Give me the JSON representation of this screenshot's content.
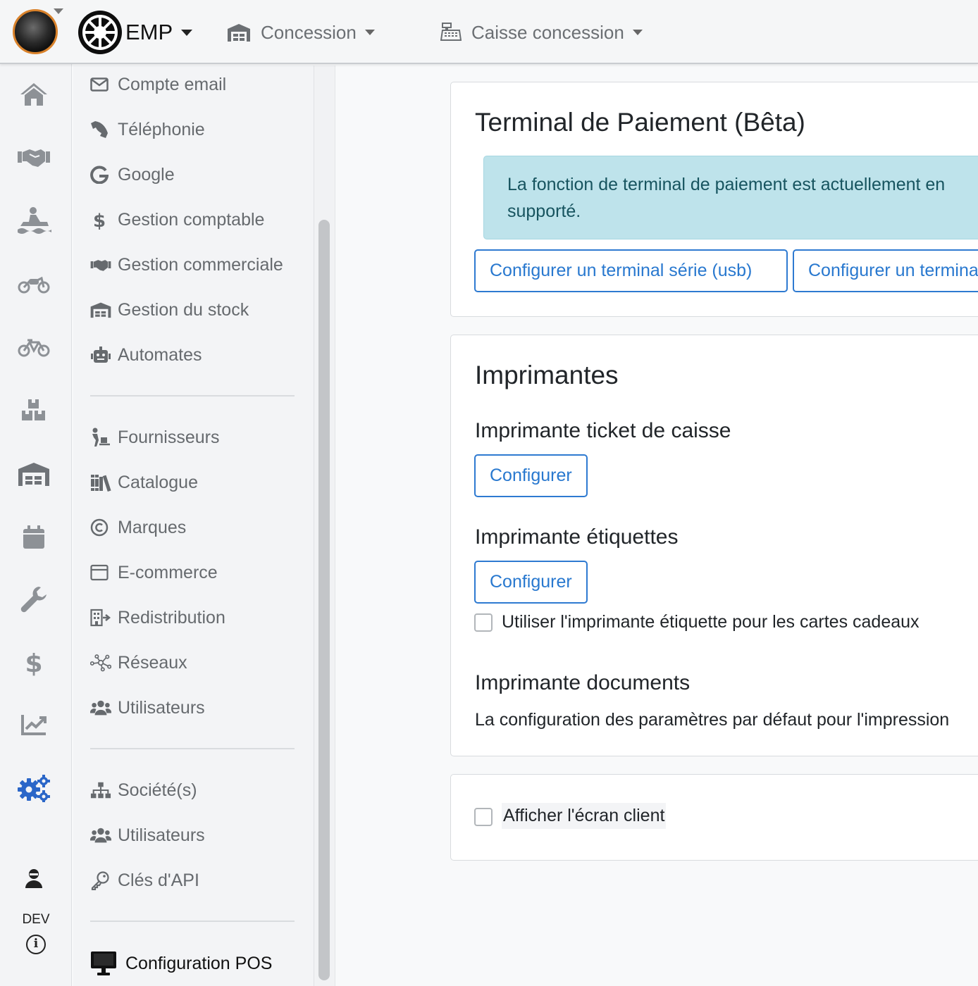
{
  "topbar": {
    "company_name": "EMP",
    "location": "Concession",
    "cash_register": "Caisse concession"
  },
  "rail": {
    "icons": [
      "home-icon",
      "handshake-icon",
      "jetski-icon",
      "motorcycle-icon",
      "bicycle-icon",
      "boxes-icon",
      "warehouse-icon",
      "calendar-icon",
      "wrench-icon",
      "dollar-icon",
      "chart-line-icon",
      "cogs-icon",
      "user-icon"
    ],
    "active_icon": "cogs-icon",
    "active_color": "#2a66c8",
    "env_label": "DEV"
  },
  "menu": {
    "items": [
      {
        "label": "Compte email",
        "icon": "envelope-icon"
      },
      {
        "label": "Téléphonie",
        "icon": "phone-icon"
      },
      {
        "label": "Google",
        "icon": "google-icon"
      },
      {
        "label": "Gestion comptable",
        "icon": "dollar-icon"
      },
      {
        "label": "Gestion commerciale",
        "icon": "handshake-icon"
      },
      {
        "label": "Gestion du stock",
        "icon": "warehouse-icon"
      },
      {
        "label": "Automates",
        "icon": "robot-icon"
      },
      {
        "label": "Fournisseurs",
        "icon": "dolly-icon"
      },
      {
        "label": "Catalogue",
        "icon": "books-icon"
      },
      {
        "label": "Marques",
        "icon": "copyright-icon"
      },
      {
        "label": "E-commerce",
        "icon": "window-icon"
      },
      {
        "label": "Redistribution",
        "icon": "building-arrow-icon"
      },
      {
        "label": "Réseaux",
        "icon": "network-icon"
      },
      {
        "label": "Utilisateurs",
        "icon": "users-icon"
      },
      {
        "label": "Société(s)",
        "icon": "sitemap-icon"
      },
      {
        "label": "Utilisateurs",
        "icon": "users-icon"
      },
      {
        "label": "Clés d'API",
        "icon": "key-icon"
      },
      {
        "label": "Configuration POS",
        "icon": "desktop-icon"
      }
    ],
    "active_item": "Configuration POS"
  },
  "terminal": {
    "title": "Terminal de Paiement (Bêta)",
    "alert_line1": "La fonction de terminal de paiement est actuellement en",
    "alert_line2": "supporté.",
    "btn_serial": "Configurer un terminal série (usb)",
    "btn_other": "Configurer un terminal"
  },
  "printers": {
    "title": "Imprimantes",
    "receipt_title": "Imprimante ticket de caisse",
    "receipt_btn": "Configurer",
    "label_title": "Imprimante étiquettes",
    "label_btn": "Configurer",
    "gift_checkbox_label": "Utiliser l'imprimante étiquette pour les cartes cadeaux",
    "gift_checkbox_checked": false,
    "documents_title": "Imprimante documents",
    "documents_text": "La configuration des paramètres par défaut pour l'impression"
  },
  "customer_display": {
    "checkbox_label": "Afficher l'écran client",
    "checked": false
  },
  "colors": {
    "primary": "#2878cf",
    "alert_bg": "#bee3eb",
    "alert_text": "#17545f"
  }
}
